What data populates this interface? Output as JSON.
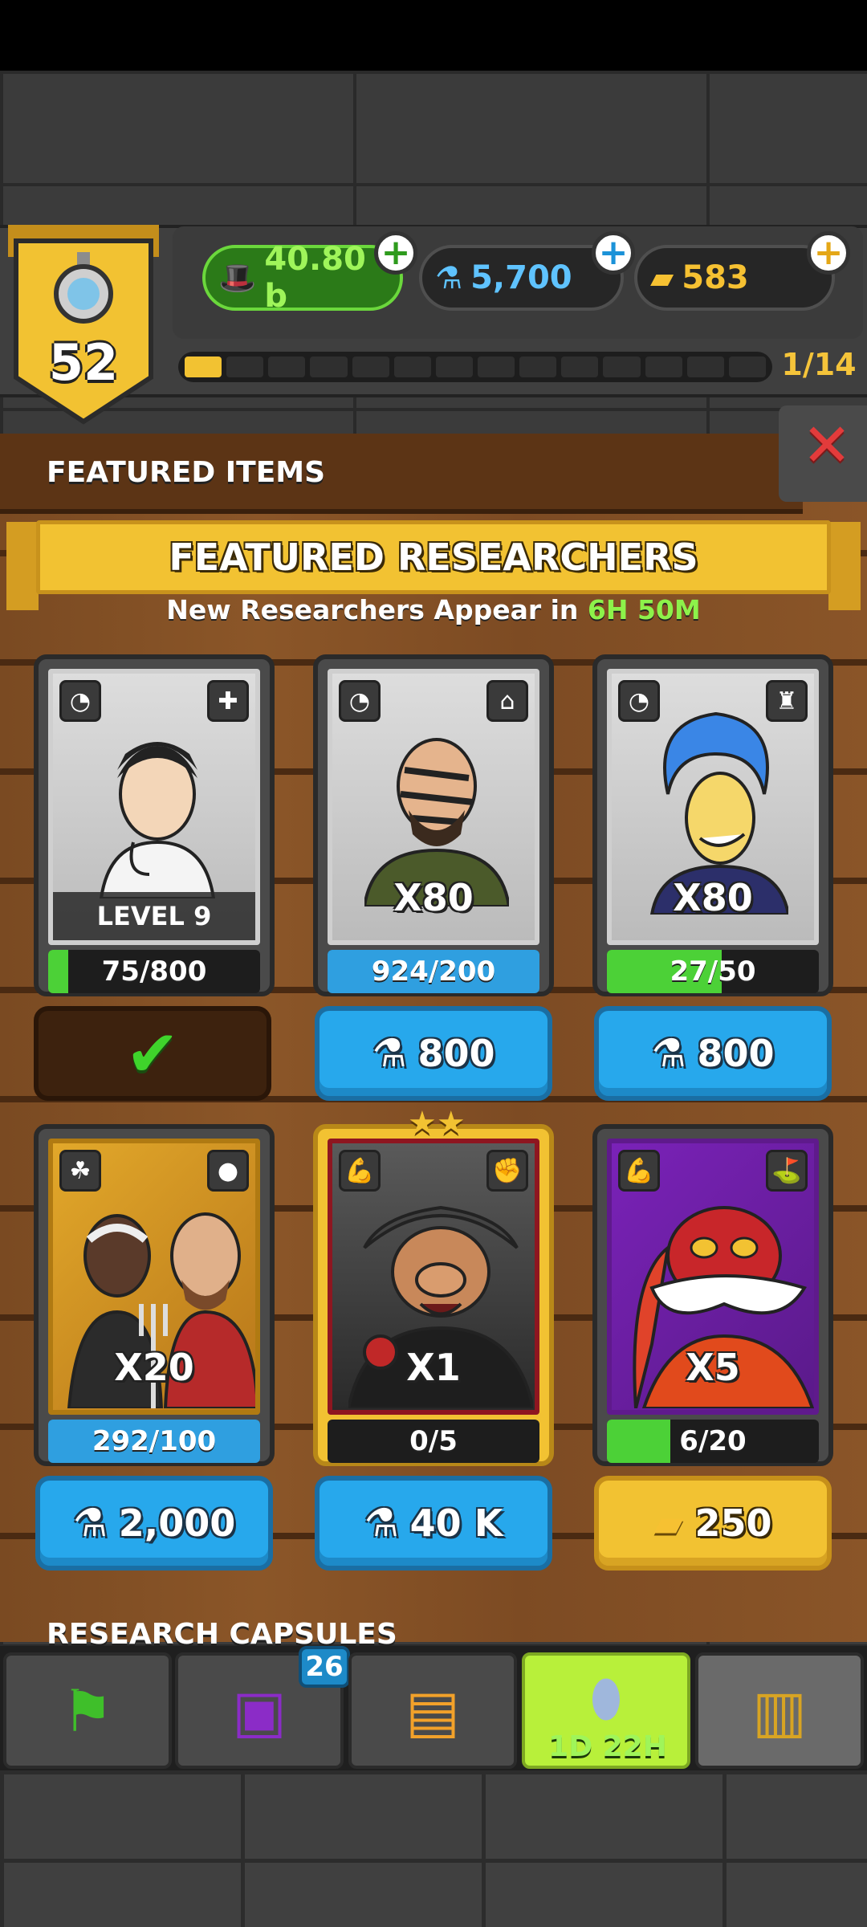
{
  "header": {
    "level": "52",
    "currencies": {
      "cash": "40.80 b",
      "research": "5,700",
      "gold": "583"
    },
    "progress": {
      "label": "1/14",
      "value": 1,
      "max": 14
    }
  },
  "featured_items": {
    "title": "FEATURED ITEMS",
    "banner": "FEATURED RESEARCHERS",
    "subtitle_prefix": "New Researchers Appear in ",
    "subtitle_time": "6H 50M",
    "cards": [
      {
        "overlay": "LEVEL 9",
        "bar": "75/800",
        "fill": 0.09375,
        "barColor": "#4cd137",
        "price": "",
        "currency": "done"
      },
      {
        "overlay": "X80",
        "bar": "924/200",
        "fill": 1,
        "barColor": "#2f9fe0",
        "price": "800",
        "currency": "research"
      },
      {
        "overlay": "X80",
        "bar": "27/50",
        "fill": 0.54,
        "barColor": "#4cd137",
        "price": "800",
        "currency": "research"
      },
      {
        "overlay": "X20",
        "bar": "292/100",
        "fill": 1,
        "barColor": "#2f9fe0",
        "price": "2,000",
        "currency": "research"
      },
      {
        "overlay": "X1",
        "bar": "0/5",
        "fill": 0,
        "barColor": "#4cd137",
        "price": "40 K",
        "currency": "research"
      },
      {
        "overlay": "X5",
        "bar": "6/20",
        "fill": 0.3,
        "barColor": "#4cd137",
        "price": "250",
        "currency": "gold"
      }
    ]
  },
  "research_capsules": {
    "title": "RESEARCH CAPSULES"
  },
  "tabs": {
    "cards_badge": "26",
    "capsule_timer": "1D 22H"
  },
  "colors": {
    "accent_gold": "#f2c232",
    "button_blue": "#27a8ec",
    "cash_green": "#2b7a18",
    "close_red": "#e33b3b"
  }
}
